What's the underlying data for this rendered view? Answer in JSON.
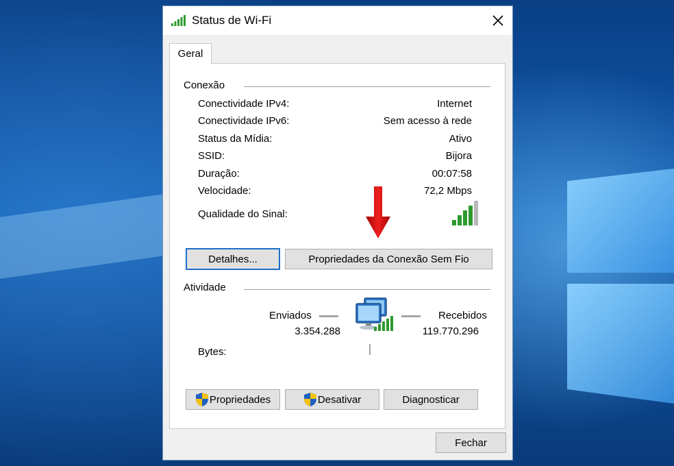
{
  "window": {
    "title": "Status de Wi-Fi",
    "icon": "wifi-signal-icon",
    "close_icon": "close-icon"
  },
  "tabs": [
    {
      "label": "Geral",
      "selected": true
    }
  ],
  "connection": {
    "group_label": "Conexão",
    "rows": [
      {
        "label": "Conectividade IPv4:",
        "value": "Internet"
      },
      {
        "label": "Conectividade IPv6:",
        "value": "Sem acesso à rede"
      },
      {
        "label": "Status da Mídia:",
        "value": "Ativo"
      },
      {
        "label": "SSID:",
        "value": "Bijora"
      },
      {
        "label": "Duração:",
        "value": "00:07:58"
      },
      {
        "label": "Velocidade:",
        "value": "72,2 Mbps"
      }
    ],
    "signal_label": "Qualidade do Sinal:",
    "signal_bars_total": 5,
    "signal_bars_filled": 4,
    "signal_color": "#2e9a2e",
    "details_button": "Detalhes...",
    "wireless_properties_button": "Propriedades da Conexão Sem Fio"
  },
  "annotation": {
    "icon": "red-arrow-down-icon",
    "color": "#d40000"
  },
  "activity": {
    "group_label": "Atividade",
    "sent_label": "Enviados",
    "received_label": "Recebidos",
    "bytes_label": "Bytes:",
    "bytes_sent": "3.354.288",
    "bytes_received": "119.770.296",
    "icon": "network-computers-icon"
  },
  "buttons": {
    "properties": "Propriedades",
    "disable": "Desativar",
    "diagnose": "Diagnosticar",
    "close": "Fechar",
    "shield_icon": "uac-shield-icon"
  },
  "colors": {
    "dialog_bg": "#f0f0f0",
    "panel_bg": "#ffffff",
    "default_button_border": "#1c6fc9",
    "desktop_bg": "#0c4f9a"
  }
}
